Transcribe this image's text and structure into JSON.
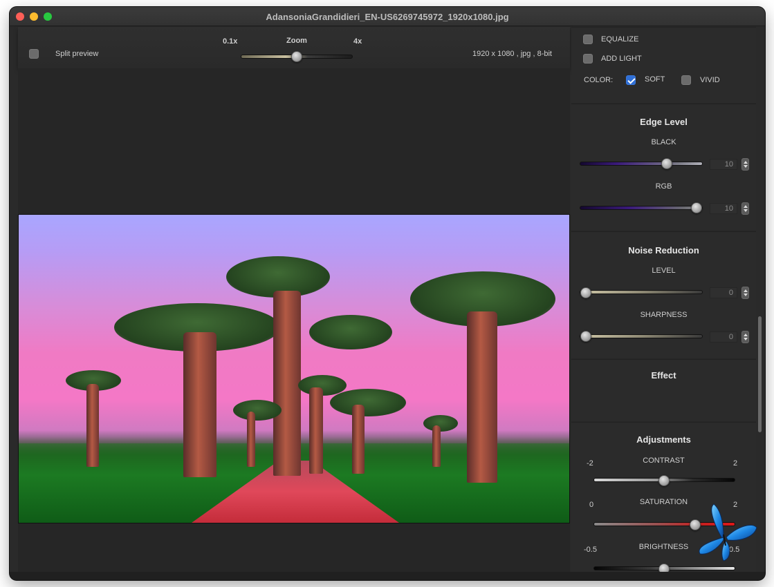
{
  "window": {
    "title": "AdansoniaGrandidieri_EN-US6269745972_1920x1080.jpg"
  },
  "toolbar": {
    "split_preview_label": "Split preview",
    "split_preview_checked": false,
    "zoom_label": "Zoom",
    "zoom_min_label": "0.1x",
    "zoom_max_label": "4x",
    "zoom_value": 0.5,
    "image_info": "1920 x 1080 , jpg , 8-bit"
  },
  "options": {
    "equalize_label": "EQUALIZE",
    "equalize_checked": false,
    "add_light_label": "ADD LIGHT",
    "add_light_checked": false,
    "color_label": "COLOR:",
    "soft_label": "SOFT",
    "soft_checked": true,
    "vivid_label": "VIVID",
    "vivid_checked": false
  },
  "edge_level": {
    "title": "Edge Level",
    "black_label": "BLACK",
    "black_value": "10",
    "black_fraction": 0.76,
    "rgb_label": "RGB",
    "rgb_value": "10",
    "rgb_fraction": 1.0
  },
  "noise_reduction": {
    "title": "Noise Reduction",
    "level_label": "LEVEL",
    "level_value": "0",
    "level_fraction": 0.0,
    "sharpness_label": "SHARPNESS",
    "sharpness_value": "0",
    "sharpness_fraction": 0.0
  },
  "effect": {
    "title": "Effect"
  },
  "adjustments": {
    "title": "Adjustments",
    "contrast_label": "CONTRAST",
    "contrast_min": "-2",
    "contrast_max": "2",
    "contrast_fraction": 0.5,
    "saturation_label": "SATURATION",
    "saturation_min": "0",
    "saturation_max": "2",
    "saturation_fraction": 0.72,
    "brightness_label": "BRIGHTNESS",
    "brightness_min": "-0.5",
    "brightness_max": "0.5",
    "brightness_fraction": 0.5
  },
  "colors": {
    "accent": "#2f6fd6",
    "purple_track": "#3a1a7a",
    "red_track": "#c42020"
  }
}
